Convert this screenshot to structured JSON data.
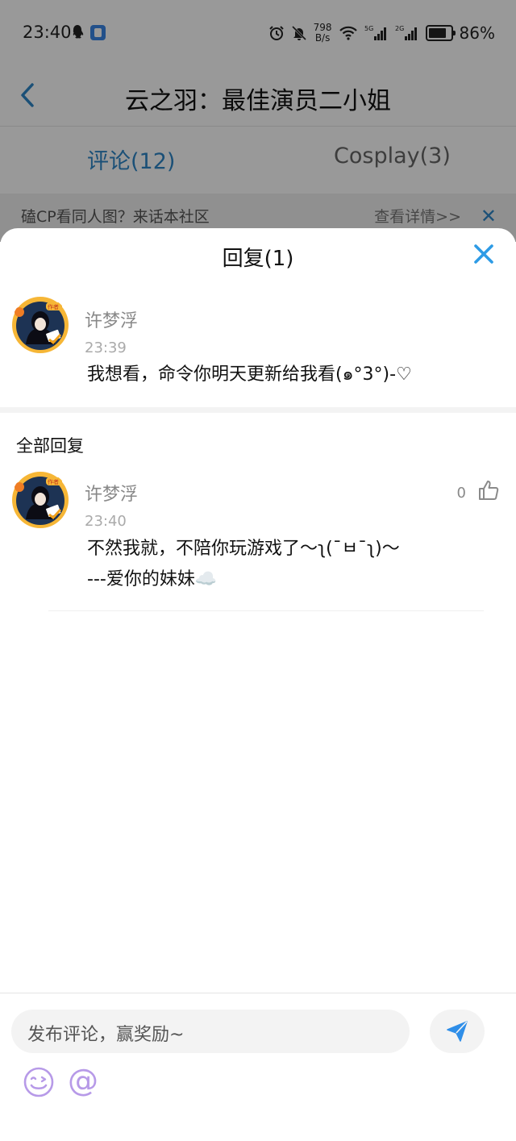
{
  "status_bar": {
    "time": "23:40",
    "speed_value": "798",
    "speed_unit": "B/s",
    "battery": "86%"
  },
  "header": {
    "title": "云之羽：最佳演员二小姐"
  },
  "tabs": [
    {
      "label": "评论(12)",
      "active": true
    },
    {
      "label": "Cosplay(3)",
      "active": false
    }
  ],
  "banner": {
    "text": "磕CP看同人图？来话本社区",
    "link": "查看详情>>"
  },
  "sheet": {
    "title": "回复(1)",
    "original": {
      "name": "许梦浮",
      "time": "23:39",
      "text": "我想看，命令你明天更新给我看(๑°3°)-♡"
    },
    "all_replies_label": "全部回复",
    "reply": {
      "name": "许梦浮",
      "time": "23:40",
      "line1": "不然我就，不陪你玩游戏了～ʅ(¯ㅂ¯ʅ)～",
      "line2": "---爱你的妹妹☁️",
      "likes": "0"
    }
  },
  "composer": {
    "placeholder": "发布评论，赢奖励~",
    "at_symbol": "@"
  },
  "colors": {
    "accent_blue": "#2d85c6",
    "close_blue": "#2d9be6",
    "send_blue": "#2f8ee8",
    "emoji_purple": "#b79ae8"
  }
}
